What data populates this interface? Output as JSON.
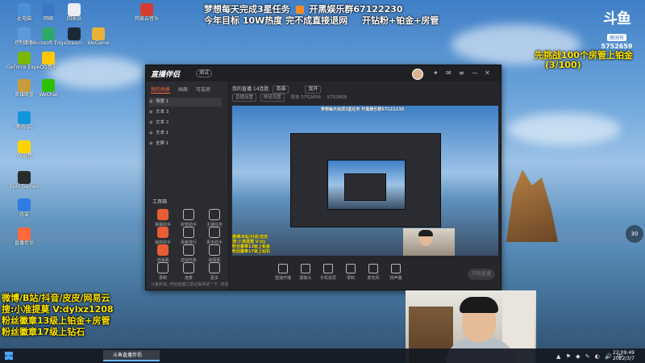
{
  "overlay": {
    "top_line1": "梦想每天完成3星任务",
    "top_line1b": "开黑娱乐群67122230",
    "top_line2": "今年目标 10W热度 完不成直接退网",
    "top_line2b": "开钻粉+铂金+房管",
    "challenge": "先挑战100个房管上铂金",
    "challenge_progress": "(3/100)",
    "left_lines": [
      "微博/B站/抖音/皮皮/网易云",
      "搜:小准提莫  V:dylxz1208",
      "粉丝徽章13级上铂金+房管",
      "粉丝徽章17级上钻石"
    ]
  },
  "logo": {
    "big": "斗鱼",
    "tag": "房间号",
    "room": "5752659"
  },
  "volume_badge": "30",
  "desktop_icons": [
    {
      "label": "此电脑",
      "color": "#4a90d9"
    },
    {
      "label": "网络",
      "color": "#3b78c4"
    },
    {
      "label": "回收站",
      "color": "#e9eef3"
    },
    {
      "label": "控制面板",
      "color": "#5a9ad9"
    },
    {
      "label": "Microsoft Edge",
      "color": "#2fa66b"
    },
    {
      "label": "Steam",
      "color": "#1b2838"
    },
    {
      "label": "WeGame",
      "color": "#e8b23a"
    },
    {
      "label": "网易云音乐",
      "color": "#d43c33"
    },
    {
      "label": "GeForce Experience",
      "color": "#76b900"
    },
    {
      "label": "QQ音乐",
      "color": "#ffc800"
    },
    {
      "label": "英雄联盟",
      "color": "#c89b3c"
    },
    {
      "label": "WeChat",
      "color": "#2dc100"
    },
    {
      "label": "腾讯QQ",
      "color": "#1296db"
    },
    {
      "label": "YY语音",
      "color": "#ffd300"
    },
    {
      "label": "Epic Games",
      "color": "#2b2b2b"
    },
    {
      "label": "迅雷",
      "color": "#2f7de1"
    },
    {
      "label": "直播伴侣",
      "color": "#ff6a3d"
    }
  ],
  "app": {
    "brand": "直播伴侣",
    "badge": "测试",
    "tabs": [
      "我的场景",
      "画面",
      "可选项"
    ],
    "scenes": [
      "场景 1",
      "文本 3",
      "文本 2",
      "文本 1",
      "全屏 1"
    ],
    "info_title": "我的直播 14连胜",
    "info_chip1": "英雄",
    "info_chip2": "我开",
    "info2_a": "直播设置",
    "info2_b": "排班设置",
    "info2_c": "双击 5752659",
    "info2_d": "5752659",
    "toolbox_title": "工具箱",
    "tools": [
      {
        "label": "弹幕助手",
        "hot": true
      },
      {
        "label": "房管助手",
        "hot": false
      },
      {
        "label": "主播任务",
        "hot": false
      },
      {
        "label": "抽奖助手",
        "hot": true
      },
      {
        "label": "贡献排行",
        "hot": false
      },
      {
        "label": "更多助手",
        "hot": false
      },
      {
        "label": "流弹幕",
        "hot": true
      },
      {
        "label": "虚拟形象",
        "hot": false
      },
      {
        "label": "弹幕姬",
        "hot": false
      },
      {
        "label": "录制",
        "hot": false
      },
      {
        "label": "连麦",
        "hot": false
      },
      {
        "label": "更多",
        "hot": false
      }
    ],
    "notice": "斗鱼听说, 开始直播之前记得测试一下, 欢迎观看",
    "controls": [
      "直播开播",
      "摄像头",
      "手机投屏",
      "录制",
      "麦克风",
      "扬声器"
    ],
    "go_live": "开始直播",
    "preview_top": "梦想每天完成3星任务  开黑娱乐群67122230",
    "preview_yellow": "微博/B站/抖音/皮皮\n搜:小准提莫 V:dy\n粉丝徽章13级上铂金\n粉丝徽章17级上钻石"
  },
  "taskbar": {
    "app_label": "斗鱼直播伴侣",
    "time": "22:09:49",
    "date": "2022/3/7"
  }
}
